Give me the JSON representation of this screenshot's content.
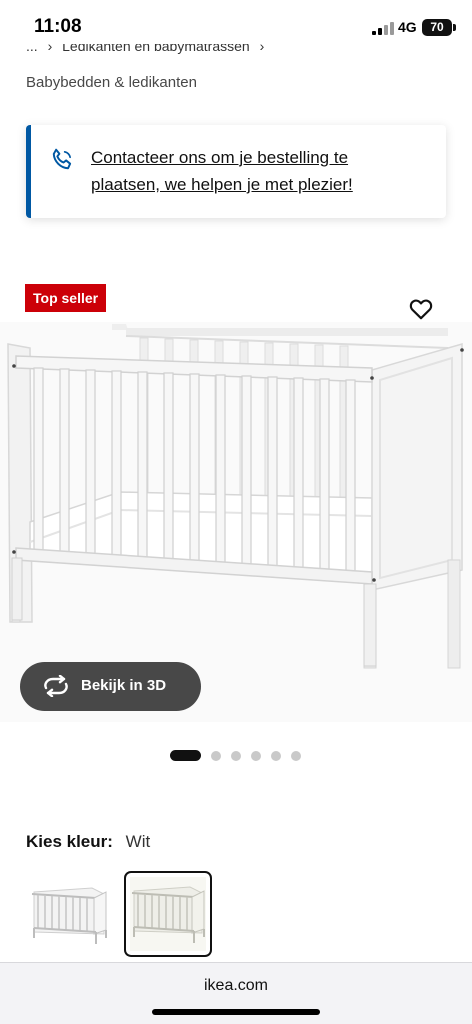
{
  "status_bar": {
    "time": "11:08",
    "network": "4G",
    "battery": "70"
  },
  "breadcrumb": {
    "prefix": "...",
    "parent": "Ledikanten en babymatrassen",
    "current": "Babybedden & ledikanten"
  },
  "contact_banner": {
    "text": "Contacteer ons om je bestelling te plaatsen, we helpen je met plezier!",
    "accent_color": "#0058a3"
  },
  "product": {
    "badge": "Top seller",
    "badge_color": "#cc0008",
    "view_3d_label": "Bekijk in 3D",
    "carousel": {
      "total": 6,
      "active": 1
    }
  },
  "color_picker": {
    "label": "Kies kleur:",
    "selected": "Wit",
    "options_count": 2,
    "selected_index": 2
  },
  "browser": {
    "url": "ikea.com"
  },
  "icons": {
    "phone": "phone-icon",
    "wishlist": "heart-icon",
    "rotate": "rotate-3d-icon",
    "breadcrumb_separator": "chevron-right-icon"
  }
}
